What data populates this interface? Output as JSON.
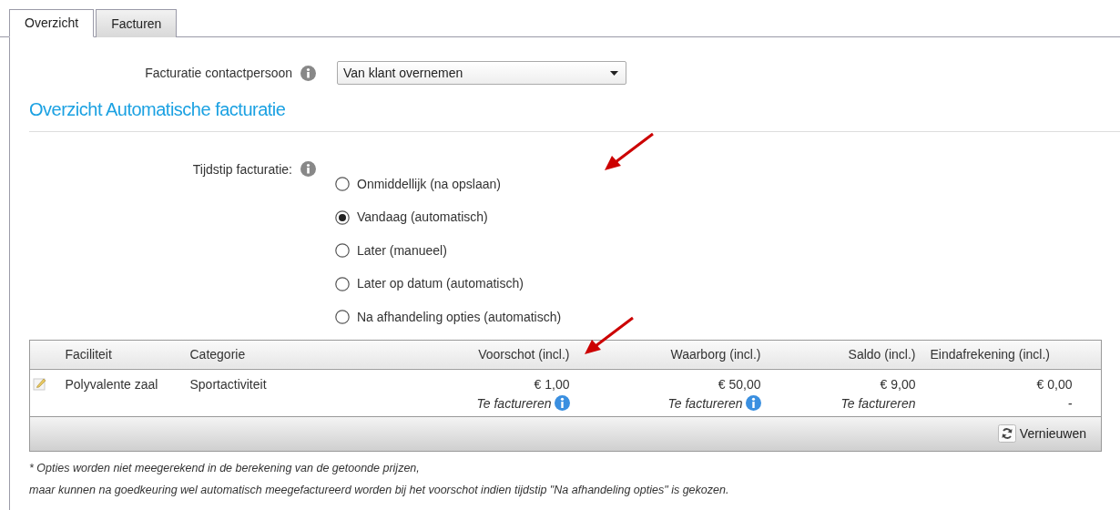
{
  "tabs": [
    {
      "label": "Overzicht",
      "selected": true
    },
    {
      "label": "Facturen",
      "selected": false
    }
  ],
  "contact": {
    "label": "Facturatie contactpersoon",
    "value": "Van klant overnemen"
  },
  "heading": "Overzicht Automatische facturatie",
  "timing": {
    "label": "Tijdstip facturatie:",
    "options": [
      {
        "label": "Onmiddellijk (na opslaan)",
        "selected": false
      },
      {
        "label": "Vandaag (automatisch)",
        "selected": true
      },
      {
        "label": "Later (manueel)",
        "selected": false
      },
      {
        "label": "Later op datum (automatisch)",
        "selected": false
      },
      {
        "label": "Na afhandeling opties (automatisch)",
        "selected": false
      }
    ]
  },
  "table": {
    "columns": [
      "Faciliteit",
      "Categorie",
      "Voorschot (incl.)",
      "Waarborg (incl.)",
      "Saldo (incl.)",
      "Eindafrekening (incl.)"
    ],
    "rows": [
      {
        "facility": "Polyvalente zaal",
        "category": "Sportactiviteit",
        "amounts": [
          {
            "amount": "€ 1,00",
            "status": "Te factureren",
            "info": true
          },
          {
            "amount": "€ 50,00",
            "status": "Te factureren",
            "info": true
          },
          {
            "amount": "€ 9,00",
            "status": "Te factureren",
            "info": false
          },
          {
            "amount": "€ 0,00",
            "status": "-",
            "info": false
          }
        ]
      }
    ],
    "footer_button": "Vernieuwen"
  },
  "notes": [
    "* Opties worden niet meegerekend in de berekening van de getoonde prijzen,",
    "maar kunnen na goedkeuring wel automatisch meegefactureerd worden bij het voorschot indien tijdstip \"Na afhandeling opties\" is gekozen."
  ]
}
